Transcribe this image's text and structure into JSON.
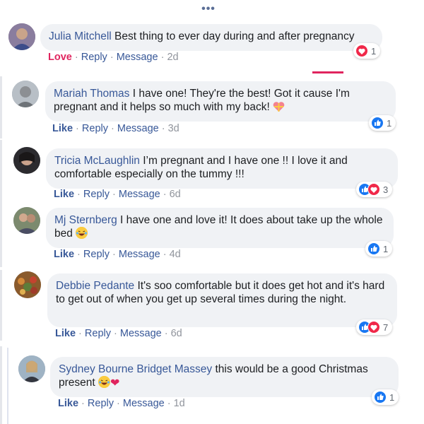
{
  "comments": [
    {
      "author": "Julia Mitchell",
      "text": "Best thing to ever day during and after pregnancy",
      "reaction_link": "Love",
      "reply": "Reply",
      "message": "Message",
      "time": "2d",
      "reaction_count": "1",
      "reactions": [
        "love"
      ]
    },
    {
      "author": "Mariah Thomas",
      "text": "I have one! They're the best! Got it cause I'm pregnant and it helps so much with my back!",
      "reaction_link": "Like",
      "reply": "Reply",
      "message": "Message",
      "time": "3d",
      "reaction_count": "1",
      "reactions": [
        "like"
      ],
      "emoji": "gift-heart"
    },
    {
      "author": "Tricia McLaughlin",
      "text": "I’m pregnant and I have one !! I love it and comfortable especially on the tummy !!!",
      "reaction_link": "Like",
      "reply": "Reply",
      "message": "Message",
      "time": "6d",
      "reaction_count": "3",
      "reactions": [
        "like",
        "love"
      ]
    },
    {
      "author": "Mj Sternberg",
      "text": "I have one and love it! It does about take up the whole bed",
      "reaction_link": "Like",
      "reply": "Reply",
      "message": "Message",
      "time": "4d",
      "reaction_count": "1",
      "reactions": [
        "like"
      ],
      "emoji": "laughing"
    },
    {
      "author": "Debbie Pedante",
      "text": "It's soo comfortable but it does get hot and it's hard to get out of when you get up several times during the night.",
      "reaction_link": "Like",
      "reply": "Reply",
      "message": "Message",
      "time": "6d",
      "reaction_count": "7",
      "reactions": [
        "like",
        "love"
      ]
    },
    {
      "author": "Sydney Bourne",
      "mention": "Bridget Massey",
      "text": "this would be a good Christmas present",
      "reaction_link": "Like",
      "reply": "Reply",
      "message": "Message",
      "time": "1d",
      "reaction_count": "1",
      "reactions": [
        "like"
      ],
      "emoji": "laughing-heart"
    }
  ],
  "colors": {
    "link": "#385898",
    "love": "#e0245e",
    "bubble": "#f0f2f5",
    "like_badge": "#1877f2",
    "love_badge": "#f02849"
  }
}
